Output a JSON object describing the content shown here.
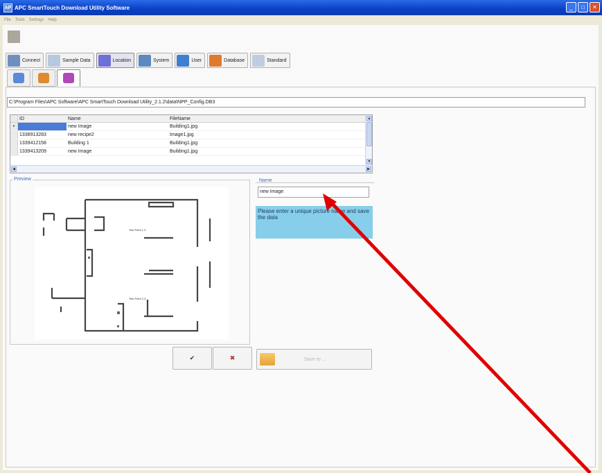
{
  "window": {
    "title": "APC SmartTouch Download Utility Software",
    "app_icon": "AP",
    "controls": [
      "_",
      "□",
      "✕"
    ]
  },
  "menu": {
    "items": [
      "File",
      "Tools",
      "Settings",
      "Help"
    ]
  },
  "main_tabs": [
    {
      "label": "Connect",
      "color": "#6f8fbf"
    },
    {
      "label": "Sample Data",
      "color": "#b8c8de"
    },
    {
      "label": "Location",
      "color": "#6f6fd8"
    },
    {
      "label": "System",
      "color": "#5a8ac0"
    },
    {
      "label": "User",
      "color": "#3f7fd0"
    },
    {
      "label": "Database",
      "color": "#e07a2e"
    },
    {
      "label": "Standard",
      "color": "#c0cce0"
    }
  ],
  "sub_tabs": [
    {
      "color": "#5a8ad8"
    },
    {
      "color": "#e08a30"
    },
    {
      "color": "#b048b8"
    }
  ],
  "path": "C:\\Program Files\\APC Software\\APC SmartTouch Download Utility_2.1.2\\data\\NPP_Config.DB3",
  "grid": {
    "columns": [
      "ID",
      "Name",
      "FileName"
    ],
    "rows": [
      {
        "indicator": "•",
        "id": "",
        "name": "new Image",
        "file": "Building1.jpg"
      },
      {
        "indicator": "",
        "id": "1338913283",
        "name": "new recipe2",
        "file": "Image1.jpg"
      },
      {
        "indicator": "",
        "id": "1339412158",
        "name": "Building 1",
        "file": "Building1.jpg"
      },
      {
        "indicator": "",
        "id": "1339413209",
        "name": "new Image",
        "file": "Building1.jpg"
      }
    ]
  },
  "preview": {
    "legend": "Preview",
    "test_point_1": "Test Point 1.3",
    "test_point_2": "Test Point 2.3"
  },
  "name_field": {
    "legend": "Name",
    "value": "new Image"
  },
  "hint": "Please enter a unique picture name and save the data",
  "buttons": {
    "ok": "✔",
    "cancel": "✖",
    "save": "Save to ..."
  },
  "colors": {
    "hint_bg": "#87ceeb",
    "arrow": "#e00000"
  }
}
